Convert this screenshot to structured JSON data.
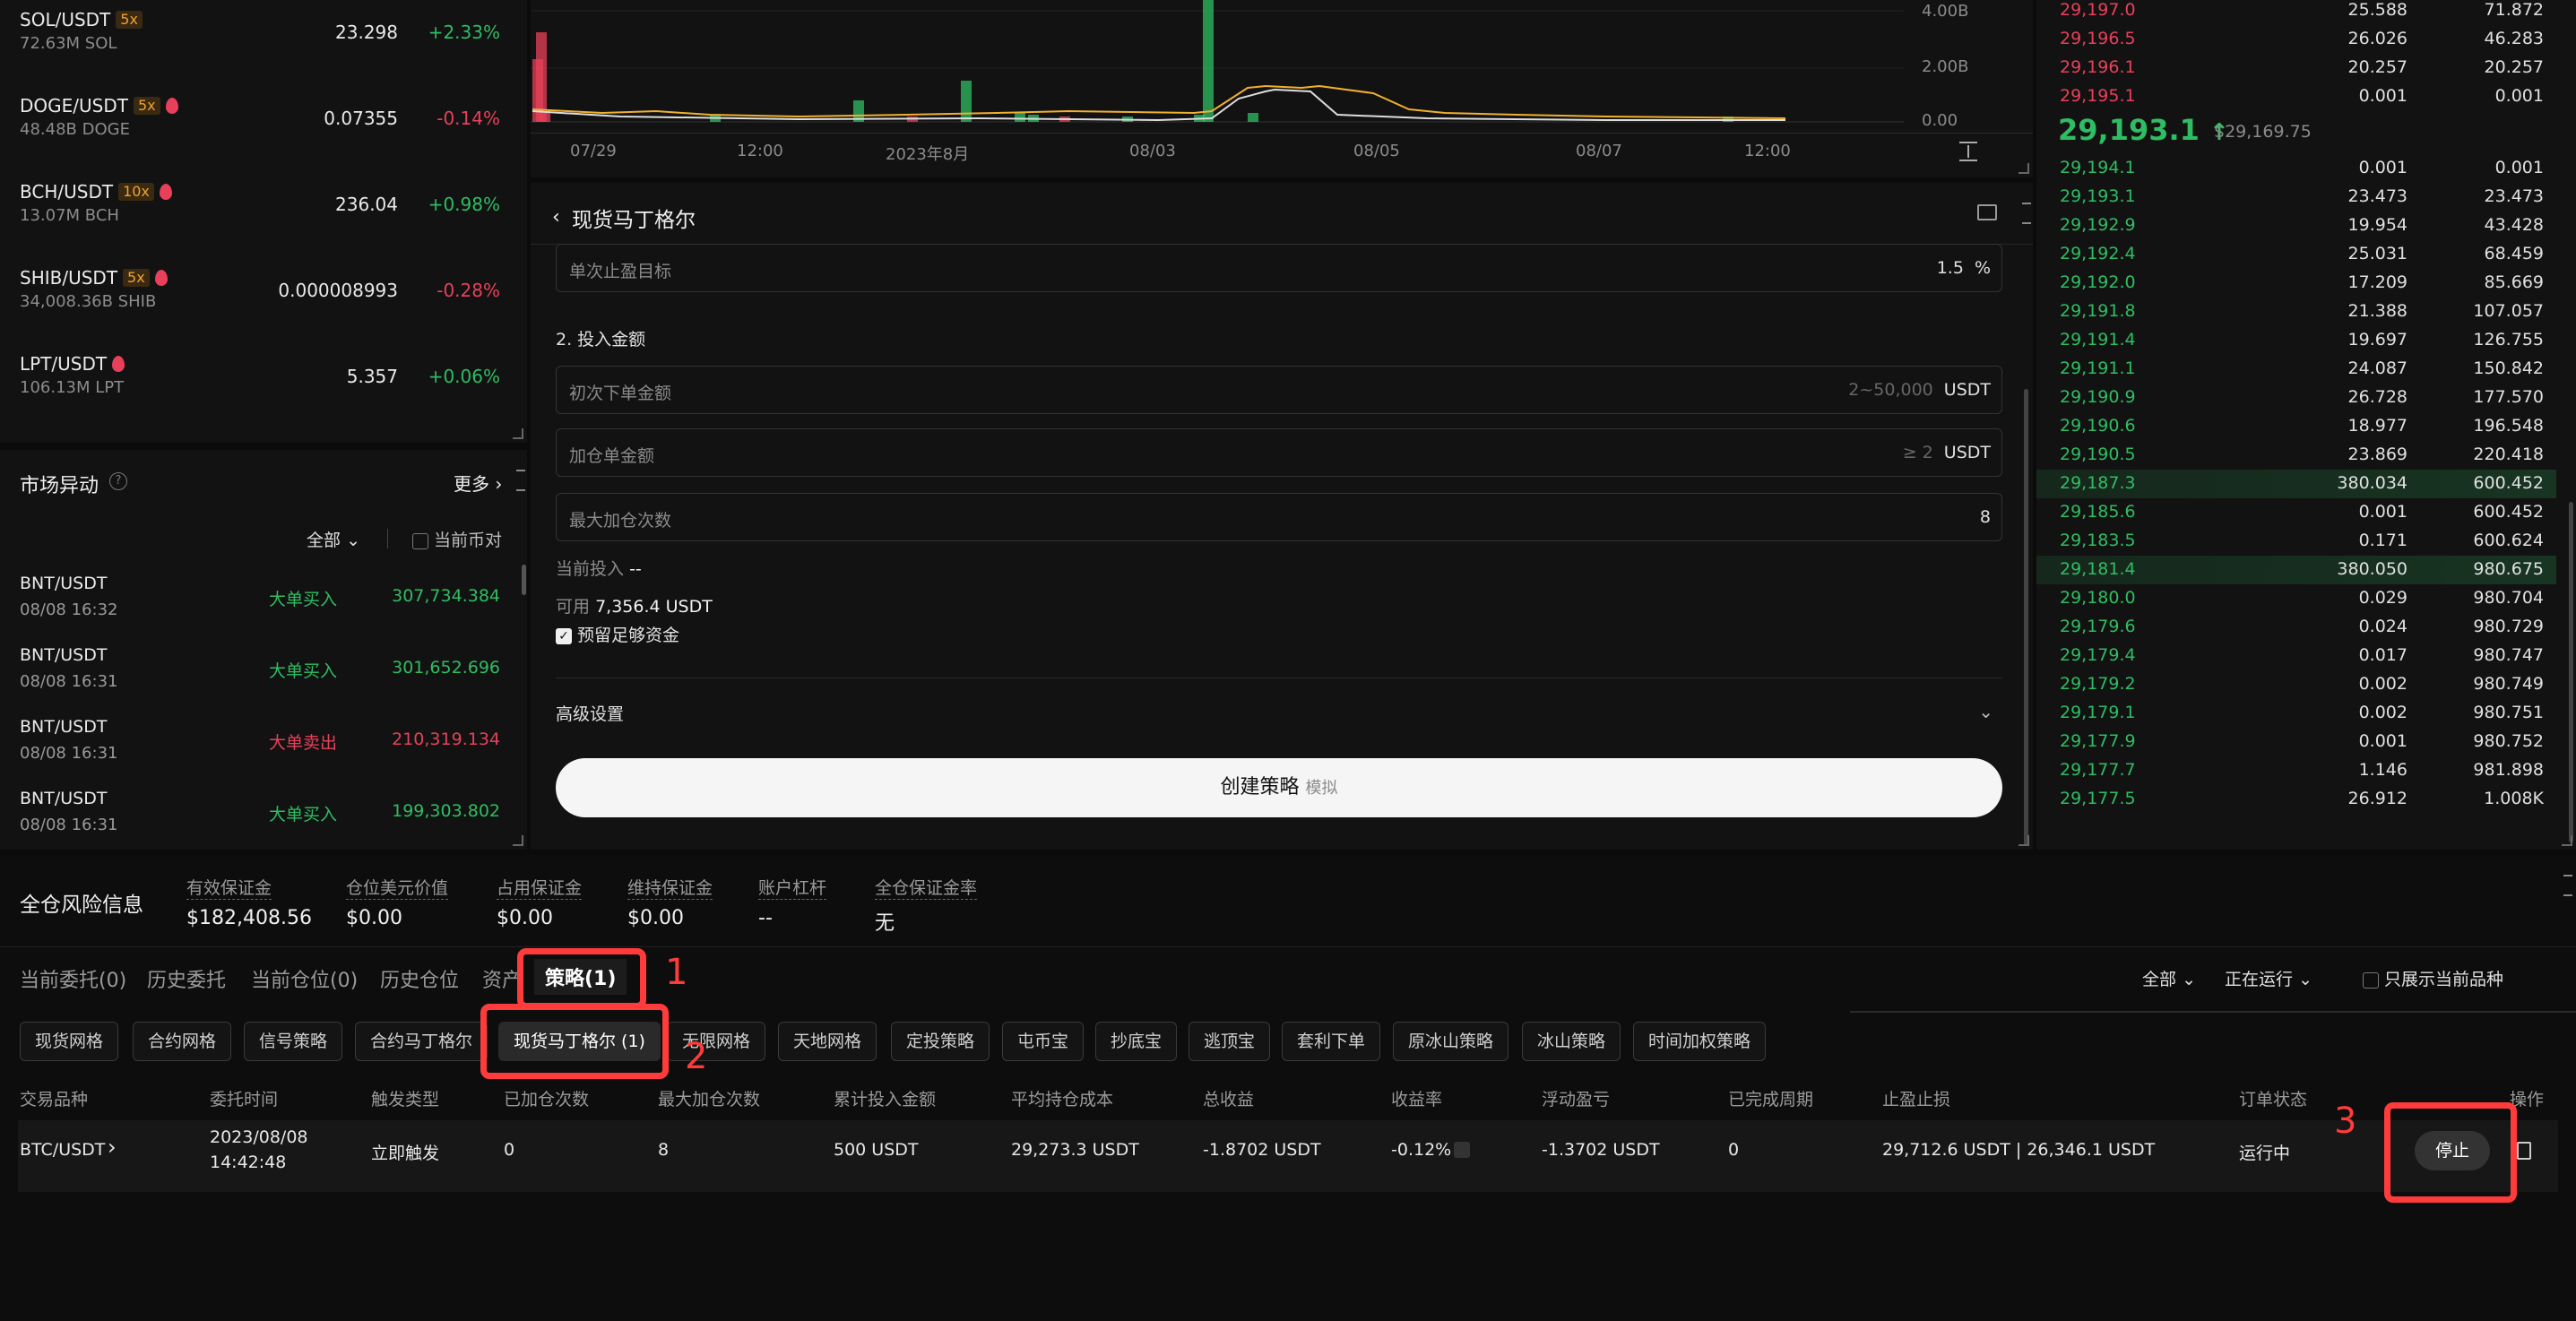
{
  "tickers": [
    {
      "symbol": "SOL/USDT",
      "leverage": "5x",
      "hot": false,
      "volume": "72.63M SOL",
      "price": "23.298",
      "change": "+2.33%",
      "up": true
    },
    {
      "symbol": "DOGE/USDT",
      "leverage": "5x",
      "hot": true,
      "volume": "48.48B DOGE",
      "price": "0.07355",
      "change": "-0.14%",
      "up": false
    },
    {
      "symbol": "BCH/USDT",
      "leverage": "10x",
      "hot": true,
      "volume": "13.07M BCH",
      "price": "236.04",
      "change": "+0.98%",
      "up": true
    },
    {
      "symbol": "SHIB/USDT",
      "leverage": "5x",
      "hot": true,
      "volume": "34,008.36B SHIB",
      "price": "0.000008993",
      "change": "-0.28%",
      "up": false
    },
    {
      "symbol": "LPT/USDT",
      "leverage": "",
      "hot": true,
      "volume": "106.13M LPT",
      "price": "5.357",
      "change": "+0.06%",
      "up": true
    }
  ],
  "market_moves": {
    "title": "市场异动",
    "more_label": "更多",
    "filter_label": "全部",
    "current_pair_label": "当前币对",
    "rows": [
      {
        "pair": "BNT/USDT",
        "time": "08/08 16:32",
        "type": "大单买入",
        "amount": "307,734.384",
        "buy": true
      },
      {
        "pair": "BNT/USDT",
        "time": "08/08 16:31",
        "type": "大单买入",
        "amount": "301,652.696",
        "buy": true
      },
      {
        "pair": "BNT/USDT",
        "time": "08/08 16:31",
        "type": "大单卖出",
        "amount": "210,319.134",
        "buy": false
      },
      {
        "pair": "BNT/USDT",
        "time": "08/08 16:31",
        "type": "大单买入",
        "amount": "199,303.802",
        "buy": true
      }
    ]
  },
  "chart": {
    "y_ticks": [
      "4.00B",
      "2.00B",
      "0.00"
    ],
    "x_ticks": [
      "07/29",
      "12:00",
      "2023年8月",
      "08/03",
      "08/05",
      "08/07",
      "12:00"
    ]
  },
  "strategy_form": {
    "title": "现货马丁格尔",
    "take_profit_label": "单次止盈目标",
    "take_profit_value": "1.5",
    "take_profit_unit": "%",
    "section2_title": "2. 投入金额",
    "initial_amount_label": "初次下单金额",
    "initial_amount_hint": "2~50,000",
    "initial_amount_unit": "USDT",
    "add_amount_label": "加仓单金额",
    "add_amount_hint": "≥ 2",
    "add_amount_unit": "USDT",
    "max_add_label": "最大加仓次数",
    "max_add_value": "8",
    "current_invest_label": "当前投入",
    "current_invest_value": "--",
    "available_label": "可用",
    "available_value": "7,356.4 USDT",
    "reserve_label": "预留足够资金",
    "advanced_label": "高级设置",
    "create_button": "创建策略",
    "create_button_sub": "模拟"
  },
  "order_book": {
    "asks": [
      {
        "price": "29,197.0",
        "amount": "25.588",
        "total": "71.872"
      },
      {
        "price": "29,196.5",
        "amount": "26.026",
        "total": "46.283"
      },
      {
        "price": "29,196.1",
        "amount": "20.257",
        "total": "20.257"
      },
      {
        "price": "29,195.1",
        "amount": "0.001",
        "total": "0.001"
      }
    ],
    "last_price": "29,193.1",
    "last_price_arrow": "↑",
    "mark_price": "$29,169.75",
    "bids": [
      {
        "price": "29,194.1",
        "amount": "0.001",
        "total": "0.001"
      },
      {
        "price": "29,193.1",
        "amount": "23.473",
        "total": "23.473"
      },
      {
        "price": "29,192.9",
        "amount": "19.954",
        "total": "43.428"
      },
      {
        "price": "29,192.4",
        "amount": "25.031",
        "total": "68.459"
      },
      {
        "price": "29,192.0",
        "amount": "17.209",
        "total": "85.669"
      },
      {
        "price": "29,191.8",
        "amount": "21.388",
        "total": "107.057"
      },
      {
        "price": "29,191.4",
        "amount": "19.697",
        "total": "126.755"
      },
      {
        "price": "29,191.1",
        "amount": "24.087",
        "total": "150.842"
      },
      {
        "price": "29,190.9",
        "amount": "26.728",
        "total": "177.570"
      },
      {
        "price": "29,190.6",
        "amount": "18.977",
        "total": "196.548"
      },
      {
        "price": "29,190.5",
        "amount": "23.869",
        "total": "220.418"
      },
      {
        "price": "29,187.3",
        "amount": "380.034",
        "total": "600.452",
        "highlight": true
      },
      {
        "price": "29,185.6",
        "amount": "0.001",
        "total": "600.452"
      },
      {
        "price": "29,183.5",
        "amount": "0.171",
        "total": "600.624"
      },
      {
        "price": "29,181.4",
        "amount": "380.050",
        "total": "980.675",
        "highlight": true
      },
      {
        "price": "29,180.0",
        "amount": "0.029",
        "total": "980.704"
      },
      {
        "price": "29,179.6",
        "amount": "0.024",
        "total": "980.729"
      },
      {
        "price": "29,179.4",
        "amount": "0.017",
        "total": "980.747"
      },
      {
        "price": "29,179.2",
        "amount": "0.002",
        "total": "980.749"
      },
      {
        "price": "29,179.1",
        "amount": "0.002",
        "total": "980.751"
      },
      {
        "price": "29,177.9",
        "amount": "0.001",
        "total": "980.752"
      },
      {
        "price": "29,177.7",
        "amount": "1.146",
        "total": "981.898"
      },
      {
        "price": "29,177.5",
        "amount": "26.912",
        "total": "1.008K"
      }
    ]
  },
  "risk_info": {
    "title": "全仓风险信息",
    "items": [
      {
        "label": "有效保证金",
        "value": "$182,408.56"
      },
      {
        "label": "仓位美元价值",
        "value": "$0.00"
      },
      {
        "label": "占用保证金",
        "value": "$0.00"
      },
      {
        "label": "维持保证金",
        "value": "$0.00"
      },
      {
        "label": "账户杠杆",
        "value": "--"
      },
      {
        "label": "全仓保证金率",
        "value": "无"
      }
    ]
  },
  "bottom_tabs": [
    "当前委托(0)",
    "历史委托",
    "当前仓位(0)",
    "历史仓位",
    "资产",
    "策略(1)"
  ],
  "bottom_filters": {
    "all": "全部",
    "running": "正在运行",
    "only_current": "只展示当前品种"
  },
  "strategy_chips": [
    "现货网格",
    "合约网格",
    "信号策略",
    "合约马丁格尔",
    "现货马丁格尔 (1)",
    "无限网格",
    "天地网格",
    "定投策略",
    "屯币宝",
    "抄底宝",
    "逃顶宝",
    "套利下单",
    "原冰山策略",
    "冰山策略",
    "时间加权策略"
  ],
  "table": {
    "headers": [
      "交易品种",
      "委托时间",
      "触发类型",
      "已加仓次数",
      "最大加仓次数",
      "累计投入金额",
      "平均持仓成本",
      "总收益",
      "收益率",
      "浮动盈亏",
      "已完成周期",
      "止盈止损",
      "订单状态",
      "操作"
    ],
    "row": {
      "pair": "BTC/USDT",
      "time_date": "2023/08/08",
      "time_clock": "14:42:48",
      "trigger": "立即触发",
      "added": "0",
      "max_add": "8",
      "invested": "500 USDT",
      "avg_cost": "29,273.3 USDT",
      "total_profit": "-1.8702 USDT",
      "yield": "-0.12%",
      "floating_pnl": "-1.3702 USDT",
      "cycles": "0",
      "tp_sl": "29,712.6 USDT | 26,346.1 USDT",
      "status": "运行中",
      "stop_button": "停止"
    }
  },
  "annotations": [
    "1",
    "2",
    "3"
  ],
  "colors": {
    "up": "#2ebd62",
    "down": "#e8405a",
    "annotation": "#ff3b3b",
    "background": "#0b0b0b",
    "panel": "#121212"
  }
}
